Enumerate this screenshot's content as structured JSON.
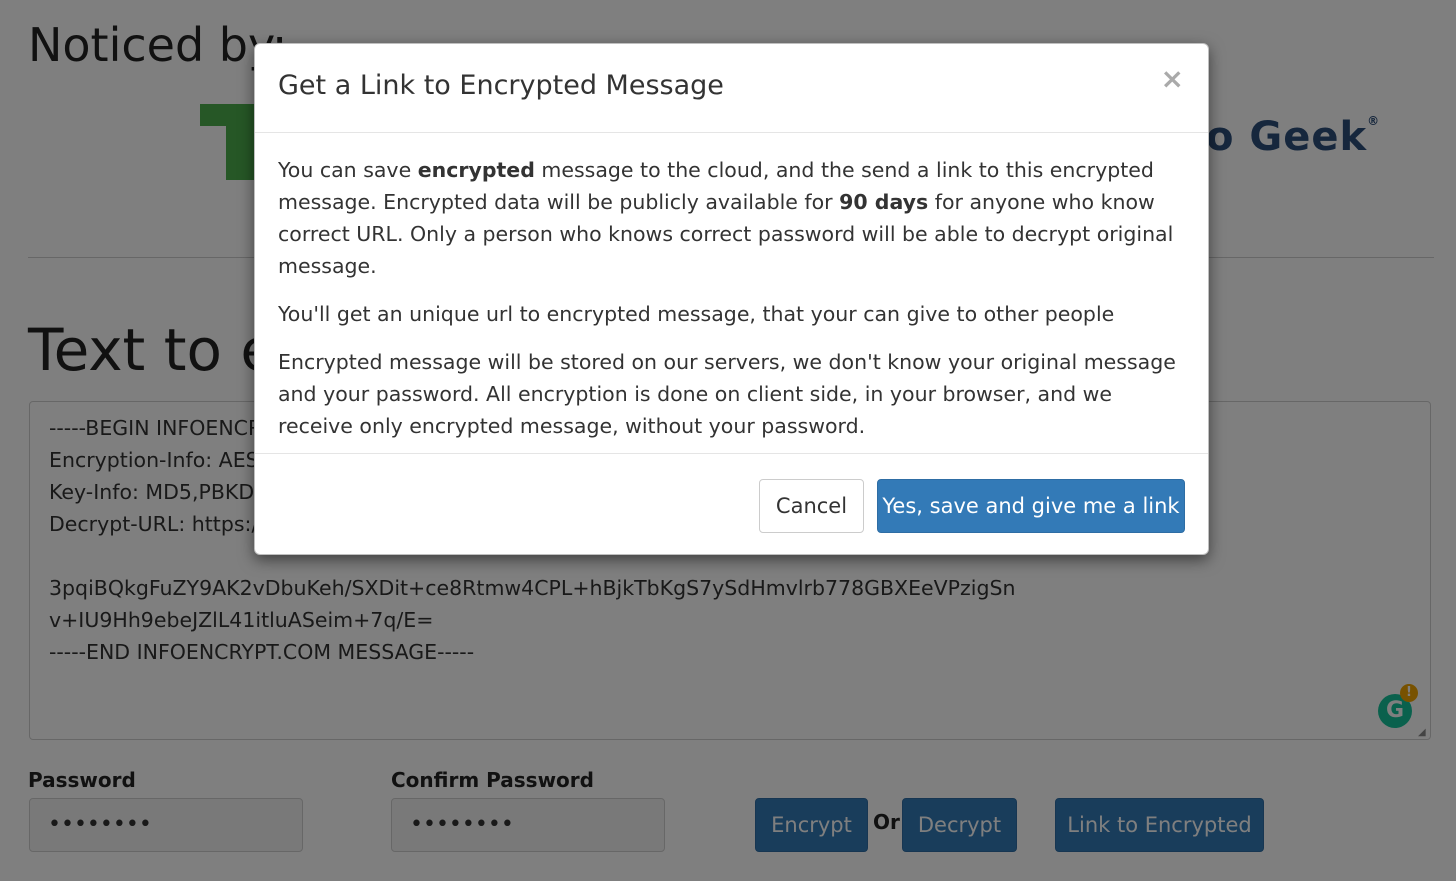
{
  "background": {
    "noticed_title": "Noticed by:",
    "logo_partial_text": "o Geek",
    "logo_trademark": "®",
    "section_title": "Text to en",
    "cipher_text": "-----BEGIN INFOENCR\nEncryption-Info: AES-\nKey-Info: MD5,PBKDF\nDecrypt-URL: https://\n\n3pqiBQkgFuZY9AK2vDbuKeh/SXDit+ce8Rtmw4CPL+hBjkTbKgS7ySdHmvlrb778GBXEeVPzigSn\nv+IU9Hh9ebeJZlL41itluASeim+7q/E=\n-----END INFOENCRYPT.COM MESSAGE-----",
    "grammarly_letter": "G",
    "grammarly_badge": "!",
    "password_label": "Password",
    "password_value": "••••••••",
    "confirm_label": "Confirm Password",
    "confirm_value": "••••••••",
    "encrypt_button": "Encrypt",
    "or_text": "Or",
    "decrypt_button": "Decrypt",
    "link_button": "Link to Encrypted"
  },
  "modal": {
    "title": "Get a Link to Encrypted Message",
    "close_glyph": "×",
    "p1_a": "You can save ",
    "p1_b": "encrypted",
    "p1_c": " message to the cloud, and the send a link to this encrypted message. Encrypted data will be publicly available for ",
    "p1_d": "90 days",
    "p1_e": " for anyone who know correct URL. Only a person who knows correct password will be able to decrypt original message.",
    "p2": "You'll get an unique url to encrypted message, that your can give to other people",
    "p3": "Encrypted message will be stored on our servers, we don't know your original message and your password. All encryption is done on client side, in your browser, and we receive only encrypted message, without your password.",
    "cancel_button": "Cancel",
    "confirm_button": "Yes, save and give me a link"
  },
  "colors": {
    "primary": "#337ab7",
    "logo_green": "#4cae4c",
    "logo_blue": "#2d4e7a",
    "backdrop": "rgba(0,0,0,0.5)"
  }
}
